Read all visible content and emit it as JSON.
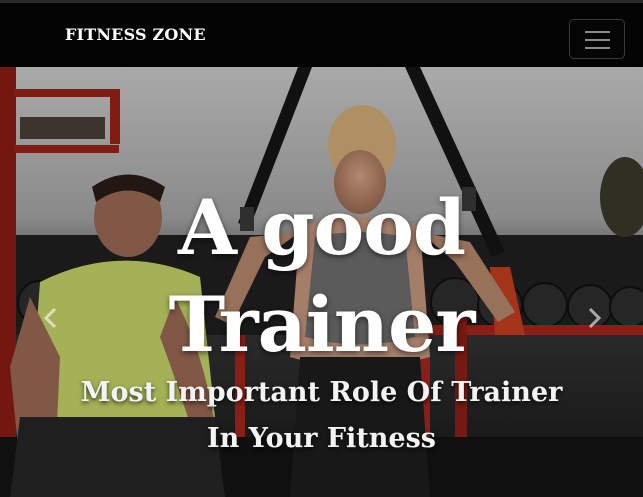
{
  "navbar": {
    "brand": "FITNESS ZONE",
    "toggle_icon": "hamburger-menu-icon"
  },
  "hero": {
    "title_line1": "A good",
    "title_line2": "Trainer",
    "subtitle_line1": "Most Important Role Of Trainer",
    "subtitle_line2": "In Your Fitness",
    "prev_icon": "chevron-left-icon",
    "next_icon": "chevron-right-icon"
  },
  "colors": {
    "navbar_bg": "#040404",
    "text": "#ffffff"
  }
}
